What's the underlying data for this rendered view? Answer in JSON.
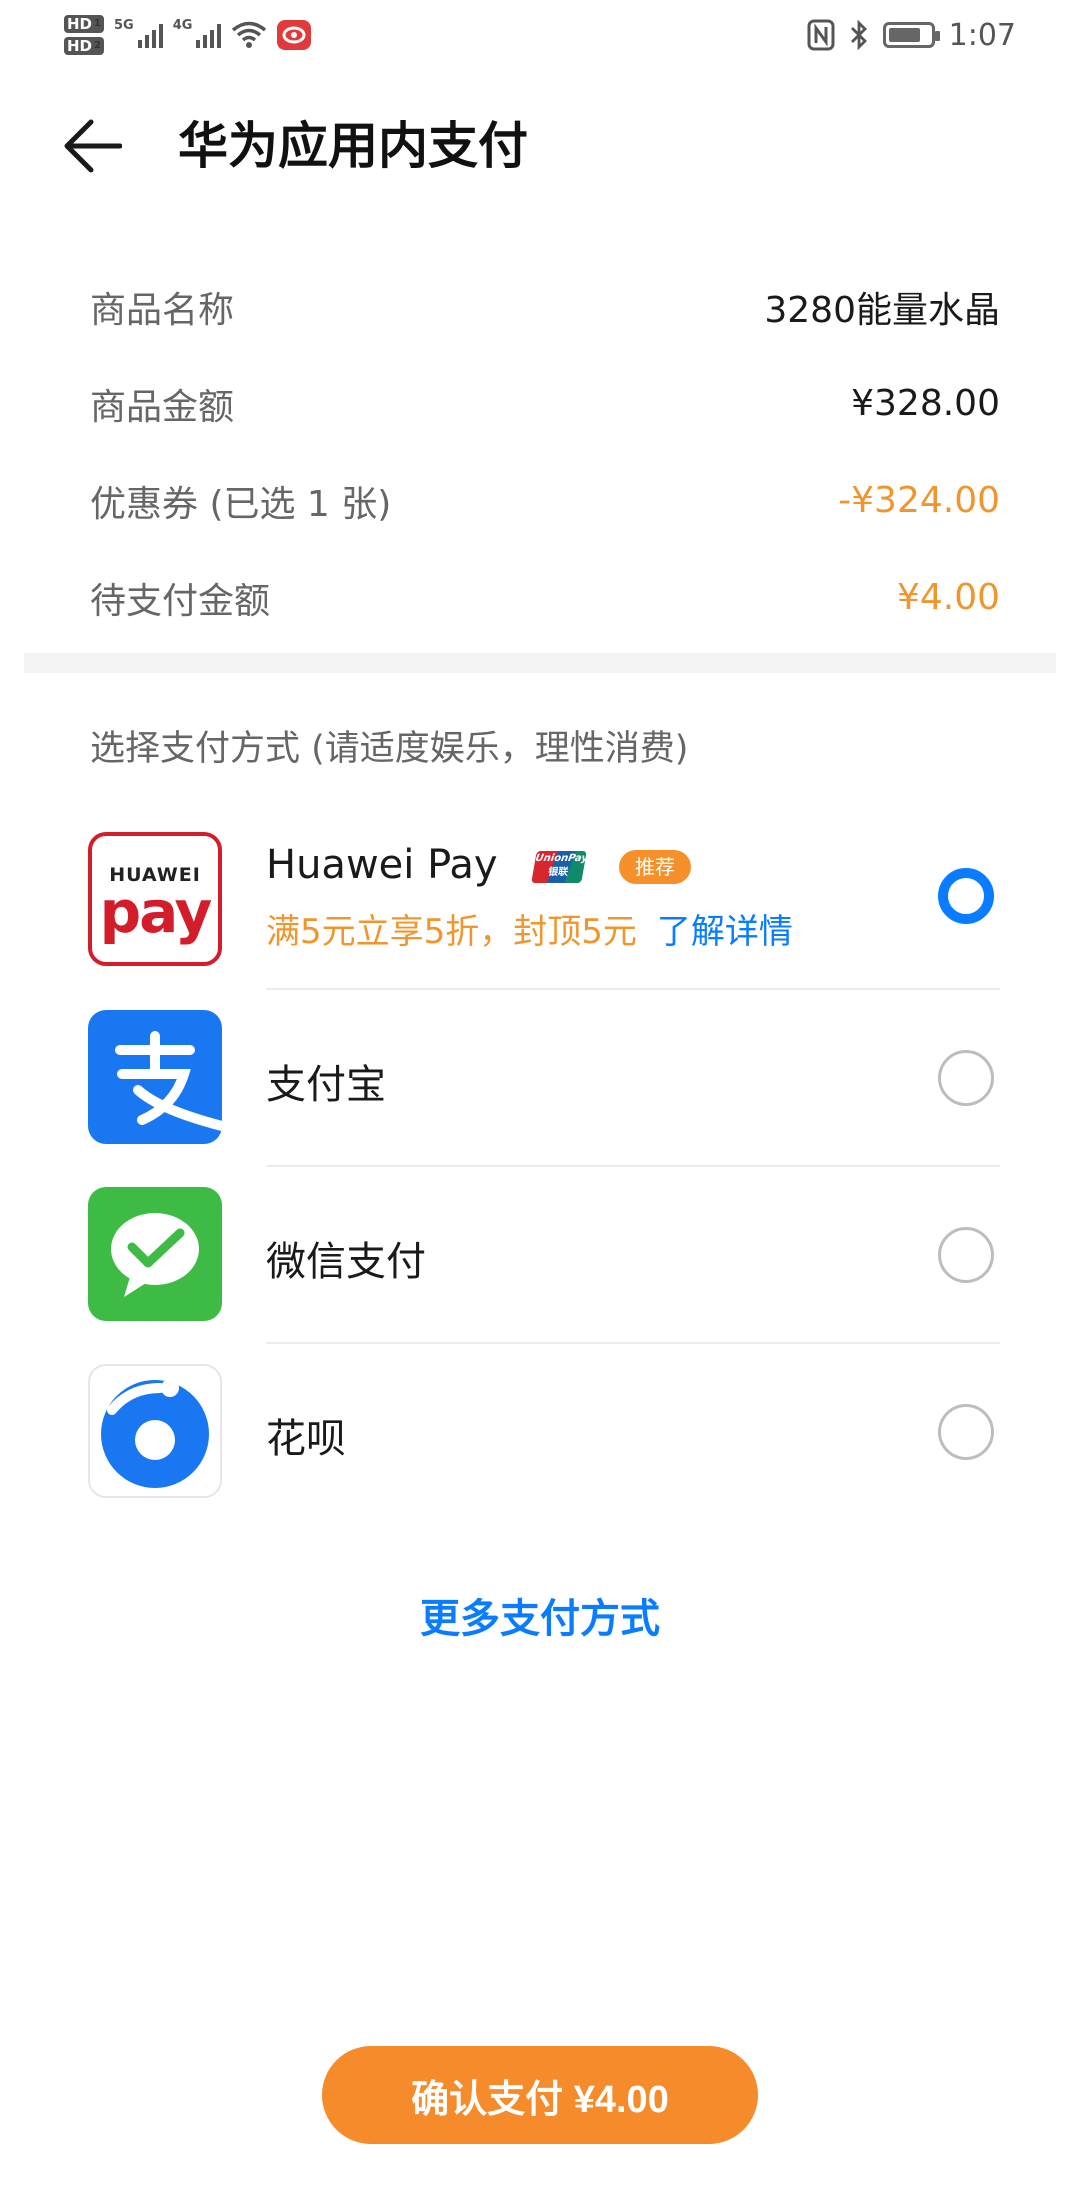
{
  "status_bar": {
    "time": "1:07",
    "sim1": "HD",
    "sim1_slot": "1",
    "sim2": "HD",
    "sim2_slot": "2",
    "net1": "5G",
    "net2": "4G"
  },
  "header": {
    "title": "华为应用内支付"
  },
  "order": {
    "rows": [
      {
        "label": "商品名称",
        "value": "3280能量水晶",
        "color": "#1a1a1a"
      },
      {
        "label": "商品金额",
        "value": "¥328.00",
        "color": "#1a1a1a"
      },
      {
        "label": "优惠券 (已选 1 张)",
        "value": "-¥324.00",
        "color": "#f0962e"
      },
      {
        "label": "待支付金额",
        "value": "¥4.00",
        "color": "#f0962e"
      }
    ]
  },
  "payment": {
    "heading": "选择支付方式 (请适度娱乐，理性消费)",
    "methods": [
      {
        "name": "Huawei Pay",
        "logo_top": "HUAWEI",
        "logo_bottom": "pay",
        "unionpay_top": "UnionPay",
        "unionpay_bottom": "银联",
        "tag": "推荐",
        "promo": "满5元立享5折，封顶5元",
        "promo_link": "了解详情",
        "selected": true
      },
      {
        "name": "支付宝",
        "logo_char": "支",
        "selected": false
      },
      {
        "name": "微信支付",
        "selected": false
      },
      {
        "name": "花呗",
        "selected": false
      }
    ],
    "more": "更多支付方式"
  },
  "confirm_button": "确认支付 ¥4.00",
  "colors": {
    "accent_blue": "#0a7cff",
    "accent_orange": "#f58b2a",
    "price_orange": "#f0962e",
    "huawei_red": "#d21e2b",
    "alipay_blue": "#1a77f2",
    "wechat_green": "#3dbb45"
  }
}
